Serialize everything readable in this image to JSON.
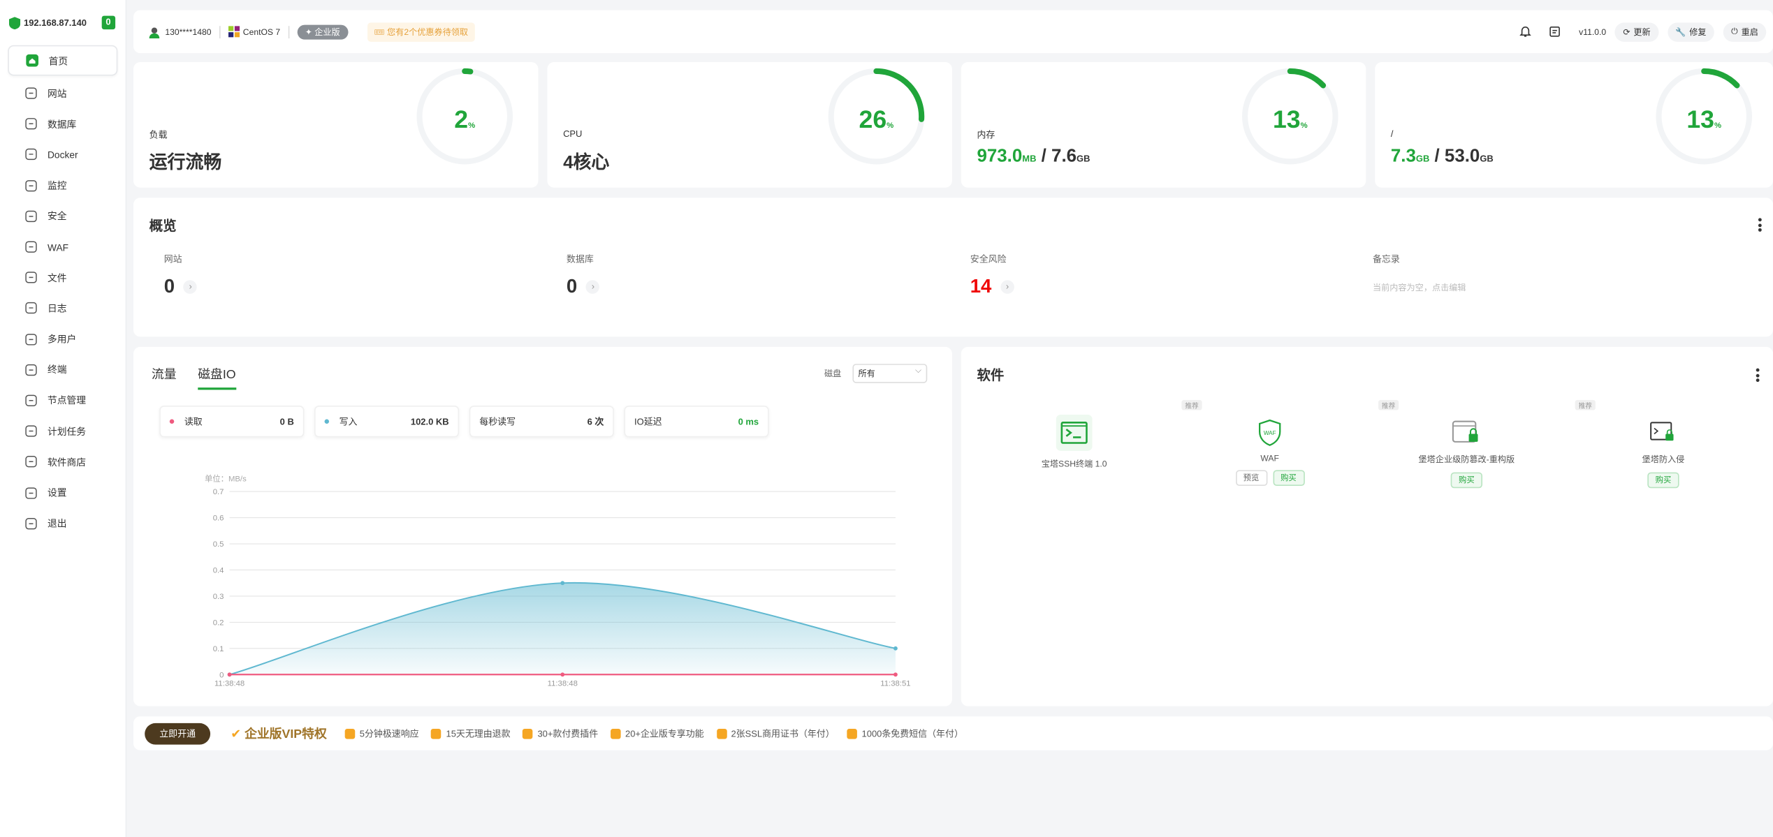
{
  "sidebar": {
    "ip": "192.168.87.140",
    "badge": "0",
    "items": [
      {
        "label": "首页"
      },
      {
        "label": "网站"
      },
      {
        "label": "数据库"
      },
      {
        "label": "Docker"
      },
      {
        "label": "监控"
      },
      {
        "label": "安全"
      },
      {
        "label": "WAF"
      },
      {
        "label": "文件"
      },
      {
        "label": "日志"
      },
      {
        "label": "多用户"
      },
      {
        "label": "终端"
      },
      {
        "label": "节点管理"
      },
      {
        "label": "计划任务"
      },
      {
        "label": "软件商店"
      },
      {
        "label": "设置"
      },
      {
        "label": "退出"
      }
    ]
  },
  "topbar": {
    "user": "130****1480",
    "os": "CentOS 7",
    "edition": "企业版",
    "coupon": "您有2个优惠券待领取",
    "version": "v11.0.0",
    "update": "更新",
    "repair": "修复",
    "restart": "重启"
  },
  "stats": {
    "load": {
      "label": "负载",
      "value": "运行流畅",
      "percent": 2,
      "unit": "%"
    },
    "cpu": {
      "label": "CPU",
      "value": "4核心",
      "percent": 26,
      "unit": "%"
    },
    "mem": {
      "label": "内存",
      "used": "973.0",
      "used_unit": "MB",
      "sep": " / ",
      "total": "7.6",
      "total_unit": "GB",
      "percent": 13,
      "unit": "%"
    },
    "disk": {
      "label": "/",
      "used": "7.3",
      "used_unit": "GB",
      "sep": " / ",
      "total": "53.0",
      "total_unit": "GB",
      "percent": 13,
      "unit": "%"
    }
  },
  "overview": {
    "title": "概览",
    "site": {
      "label": "网站",
      "value": "0"
    },
    "db": {
      "label": "数据库",
      "value": "0"
    },
    "risk": {
      "label": "安全风险",
      "value": "14"
    },
    "memo": {
      "label": "备忘录",
      "text": "当前内容为空，点击编辑"
    },
    "arrow": "›"
  },
  "io": {
    "tab_traffic": "流量",
    "tab_disk": "磁盘IO",
    "disk_label": "磁盘",
    "disk_select": "所有",
    "read_label": "读取",
    "read_value": "0 B",
    "write_label": "写入",
    "write_value": "102.0 KB",
    "ops_label": "每秒读写",
    "ops_value": "6 次",
    "lat_label": "IO延迟",
    "lat_value": "0 ms",
    "colors": {
      "read": "#ef5a7f",
      "write": "#5fb8d0",
      "accent": "#20a53a"
    }
  },
  "chart_data": {
    "type": "area",
    "unit_label": "单位：MB/s",
    "x": [
      "11:38:48",
      "11:38:48",
      "11:38:51"
    ],
    "ylim": [
      0,
      0.7
    ],
    "yticks": [
      "0",
      "0.1",
      "0.2",
      "0.3",
      "0.4",
      "0.5",
      "0.6",
      "0.7"
    ],
    "series": [
      {
        "values": [
          0,
          0.35,
          0.1
        ],
        "color": "#5fb8d0"
      },
      {
        "values": [
          0,
          0,
          0
        ],
        "color": "#ef5a7f"
      }
    ],
    "grid": true
  },
  "software": {
    "title": "软件",
    "rec": "推荐",
    "items": [
      {
        "name": "宝塔SSH终端 1.0",
        "buttons": []
      },
      {
        "name": "WAF",
        "buttons": [
          "预览",
          "购买"
        ]
      },
      {
        "name": "堡塔企业级防篡改-重构版",
        "buttons": [
          "购买"
        ]
      },
      {
        "name": "堡塔防入侵",
        "buttons": [
          "购买"
        ]
      }
    ]
  },
  "vip": {
    "open": "立即开通",
    "title": "企业版VIP特权",
    "features": [
      "5分钟极速响应",
      "15天无理由退款",
      "30+款付费插件",
      "20+企业版专享功能",
      "2张SSL商用证书（年付）",
      "1000条免费短信（年付）"
    ]
  }
}
